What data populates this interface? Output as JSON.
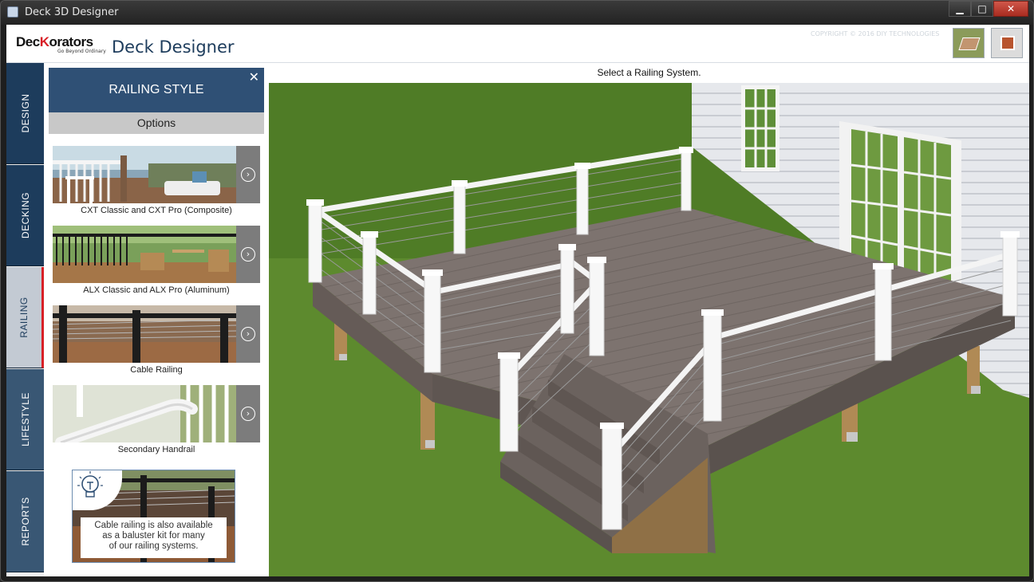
{
  "window": {
    "title": "Deck 3D Designer",
    "min_glyph": "▁",
    "max_glyph": "□",
    "close_glyph": "✕"
  },
  "header": {
    "brand_prefix": "Dec",
    "brand_x": "K",
    "brand_suffix": "orators",
    "brand_tagline": "Go Beyond Ordinary",
    "app_title": "Deck Designer",
    "copyright": "COPYRIGHT © 2016 DIY TECHNOLOGIES"
  },
  "tabs": [
    {
      "label": "DESIGN",
      "state": "normal"
    },
    {
      "label": "DECKING",
      "state": "normal"
    },
    {
      "label": "RAILING",
      "state": "active"
    },
    {
      "label": "LIFESTYLE",
      "state": "faded"
    },
    {
      "label": "REPORTS",
      "state": "faded"
    }
  ],
  "panel": {
    "title": "RAILING STYLE",
    "close_glyph": "✕",
    "options_label": "Options",
    "arrow_glyph": "›",
    "items": [
      {
        "label": "CXT Classic and CXT Pro (Composite)"
      },
      {
        "label": "ALX Classic and ALX Pro (Aluminum)"
      },
      {
        "label": "Cable Railing"
      },
      {
        "label": "Secondary Handrail"
      }
    ],
    "tip": {
      "line1": "Cable railing is also available",
      "line2": "as a baluster kit for many",
      "line3": "of our railing systems."
    }
  },
  "viewport": {
    "instruction": "Select a Railing System."
  },
  "colors": {
    "navy": "#1d3c5c",
    "accent_red": "#d81f26",
    "grass": "#5f8a2e",
    "deck": "#7d736f",
    "siding": "#e4e6ea",
    "railing_white": "#f4f4f4"
  }
}
